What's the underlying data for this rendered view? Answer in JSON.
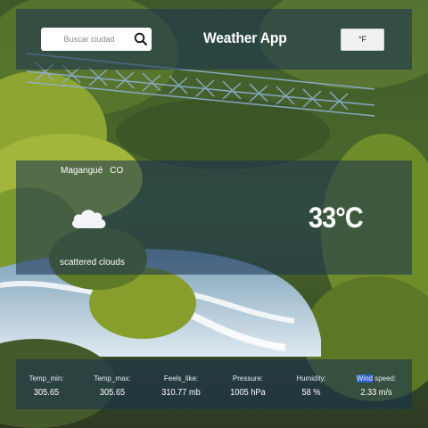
{
  "header": {
    "search_placeholder": "Buscar ciudad",
    "title": "Weather App",
    "unit_button": "°F"
  },
  "weather": {
    "city": "Magangué",
    "country": "CO",
    "condition": "scattered clouds",
    "condition_icon": "cloud-icon",
    "temperature": "33°C"
  },
  "stats": [
    {
      "label": "Temp_min:",
      "value": "305.65"
    },
    {
      "label": "Temp_max:",
      "value": "305.65"
    },
    {
      "label": "Feels_like:",
      "value": "310.77 mb"
    },
    {
      "label": "Pressure:",
      "value": "1005 hPa"
    },
    {
      "label": "Humidity:",
      "value": "58 %"
    },
    {
      "label_highlight": "Wind",
      "label_rest": " speed:",
      "value": "2.33 m/s"
    }
  ],
  "colors": {
    "panel": "#183054",
    "highlight": "#2a62c9"
  }
}
